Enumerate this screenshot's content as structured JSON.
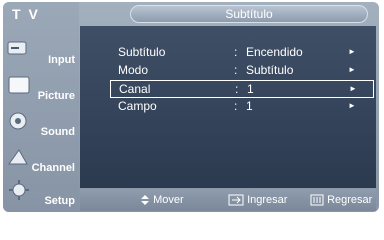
{
  "app": {
    "title": "T V"
  },
  "sidebar": {
    "items": [
      {
        "label": "Input"
      },
      {
        "label": "Picture"
      },
      {
        "label": "Sound"
      },
      {
        "label": "Channel"
      },
      {
        "label": "Setup"
      }
    ]
  },
  "header": {
    "title": "Subtítulo"
  },
  "menu": {
    "rows": [
      {
        "label": "Subtítulo",
        "separator": ":",
        "value": "Encendido",
        "arrow": "►"
      },
      {
        "label": "Modo",
        "separator": ":",
        "value": "Subtítulo",
        "arrow": "►"
      },
      {
        "label": "Canal",
        "separator": ":",
        "value": "1",
        "arrow": "►"
      },
      {
        "label": "Campo",
        "separator": ":",
        "value": "1",
        "arrow": "►"
      }
    ]
  },
  "footer": {
    "move_label": "Mover",
    "enter_label": "Ingresar",
    "return_label": "Regresar"
  }
}
